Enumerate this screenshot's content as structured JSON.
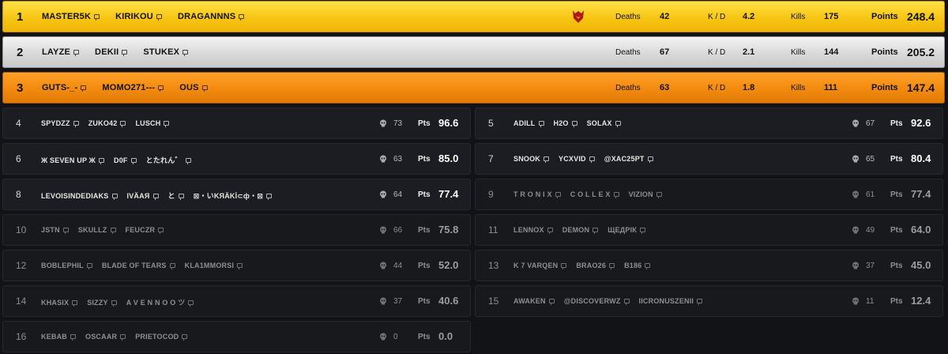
{
  "top_rows": [
    {
      "rank": "1",
      "players": [
        "MASTER5K",
        "KIRIKOU",
        "DRAGANNNS"
      ],
      "deaths_label": "Deaths",
      "deaths": "42",
      "kd_label": "K / D",
      "kd": "4.2",
      "kills_label": "Kills",
      "kills": "175",
      "points_label": "Points",
      "points": "248.4",
      "color": "#f7c513"
    },
    {
      "rank": "2",
      "players": [
        "LAYZE",
        "DEKII",
        "STUKEX"
      ],
      "deaths_label": "Deaths",
      "deaths": "67",
      "kd_label": "K / D",
      "kd": "2.1",
      "kills_label": "Kills",
      "kills": "144",
      "points_label": "Points",
      "points": "205.2",
      "color": "#d9d9d9"
    },
    {
      "rank": "3",
      "players": [
        "GUTS-_-",
        "MOMO271---",
        "OUS"
      ],
      "deaths_label": "Deaths",
      "deaths": "63",
      "kd_label": "K / D",
      "kd": "1.8",
      "kills_label": "Kills",
      "kills": "111",
      "points_label": "Points",
      "points": "147.4",
      "color": "#f28a0e"
    }
  ],
  "grid_rows": [
    {
      "rank": "4",
      "players": [
        "SPYDZZ",
        "ZUKO42",
        "LUSCH"
      ],
      "kills": "73",
      "pts_label": "Pts",
      "points": "96.6",
      "dim": false
    },
    {
      "rank": "5",
      "players": [
        "ADILL",
        "H2O",
        "SOLAX"
      ],
      "kills": "67",
      "pts_label": "Pts",
      "points": "92.6",
      "dim": false
    },
    {
      "rank": "6",
      "players": [
        "Ж SEVEN UP Ж",
        "D0F",
        "とたれん゛"
      ],
      "kills": "63",
      "pts_label": "Pts",
      "points": "85.0",
      "dim": false
    },
    {
      "rank": "7",
      "players": [
        "SNOOK",
        "YCXVID",
        "@XAC25PT"
      ],
      "kills": "65",
      "pts_label": "Pts",
      "points": "80.4",
      "dim": false
    },
    {
      "rank": "8",
      "players": [
        "LEVOISINDEDIAKS",
        "IVÄАЯ",
        "と",
        "⊠・いKЯÄKİ⊂ф・⊠"
      ],
      "kills": "64",
      "pts_label": "Pts",
      "points": "77.4",
      "dim": false
    },
    {
      "rank": "9",
      "players": [
        "T R O N I X",
        "C O L L E X",
        "VIZION"
      ],
      "kills": "61",
      "pts_label": "Pts",
      "points": "77.4",
      "dim": true
    },
    {
      "rank": "10",
      "players": [
        "JSTN",
        "SKULLZ",
        "FEUCZR"
      ],
      "kills": "66",
      "pts_label": "Pts",
      "points": "75.8",
      "dim": true
    },
    {
      "rank": "11",
      "players": [
        "LENNOX",
        "DEMON",
        "ЩЕДРІК"
      ],
      "kills": "49",
      "pts_label": "Pts",
      "points": "64.0",
      "dim": true
    },
    {
      "rank": "12",
      "players": [
        "BOBLEPHIL",
        "BLADE OF TEARS",
        "KLA1MMORSI"
      ],
      "kills": "44",
      "pts_label": "Pts",
      "points": "52.0",
      "dim": true
    },
    {
      "rank": "13",
      "players": [
        "K 7 VARQEN",
        "BRAO26",
        "B186"
      ],
      "kills": "37",
      "pts_label": "Pts",
      "points": "45.0",
      "dim": true
    },
    {
      "rank": "14",
      "players": [
        "KHASIX",
        "SIZZY",
        "A V E N N O O ツ"
      ],
      "kills": "37",
      "pts_label": "Pts",
      "points": "40.6",
      "dim": true
    },
    {
      "rank": "15",
      "players": [
        "AWAKEN",
        "@DISCOVERWZ",
        "IICRONUSZENII"
      ],
      "kills": "11",
      "pts_label": "Pts",
      "points": "12.4",
      "dim": true
    },
    {
      "rank": "16",
      "players": [
        "KEBAB",
        "OSCAAR",
        "PRIETOCOD"
      ],
      "kills": "0",
      "pts_label": "Pts",
      "points": "0.0",
      "dim": true
    }
  ],
  "icons": {
    "player": "chat-bubble-icon",
    "kills": "skull-icon",
    "crest": "team-crest-icon"
  }
}
